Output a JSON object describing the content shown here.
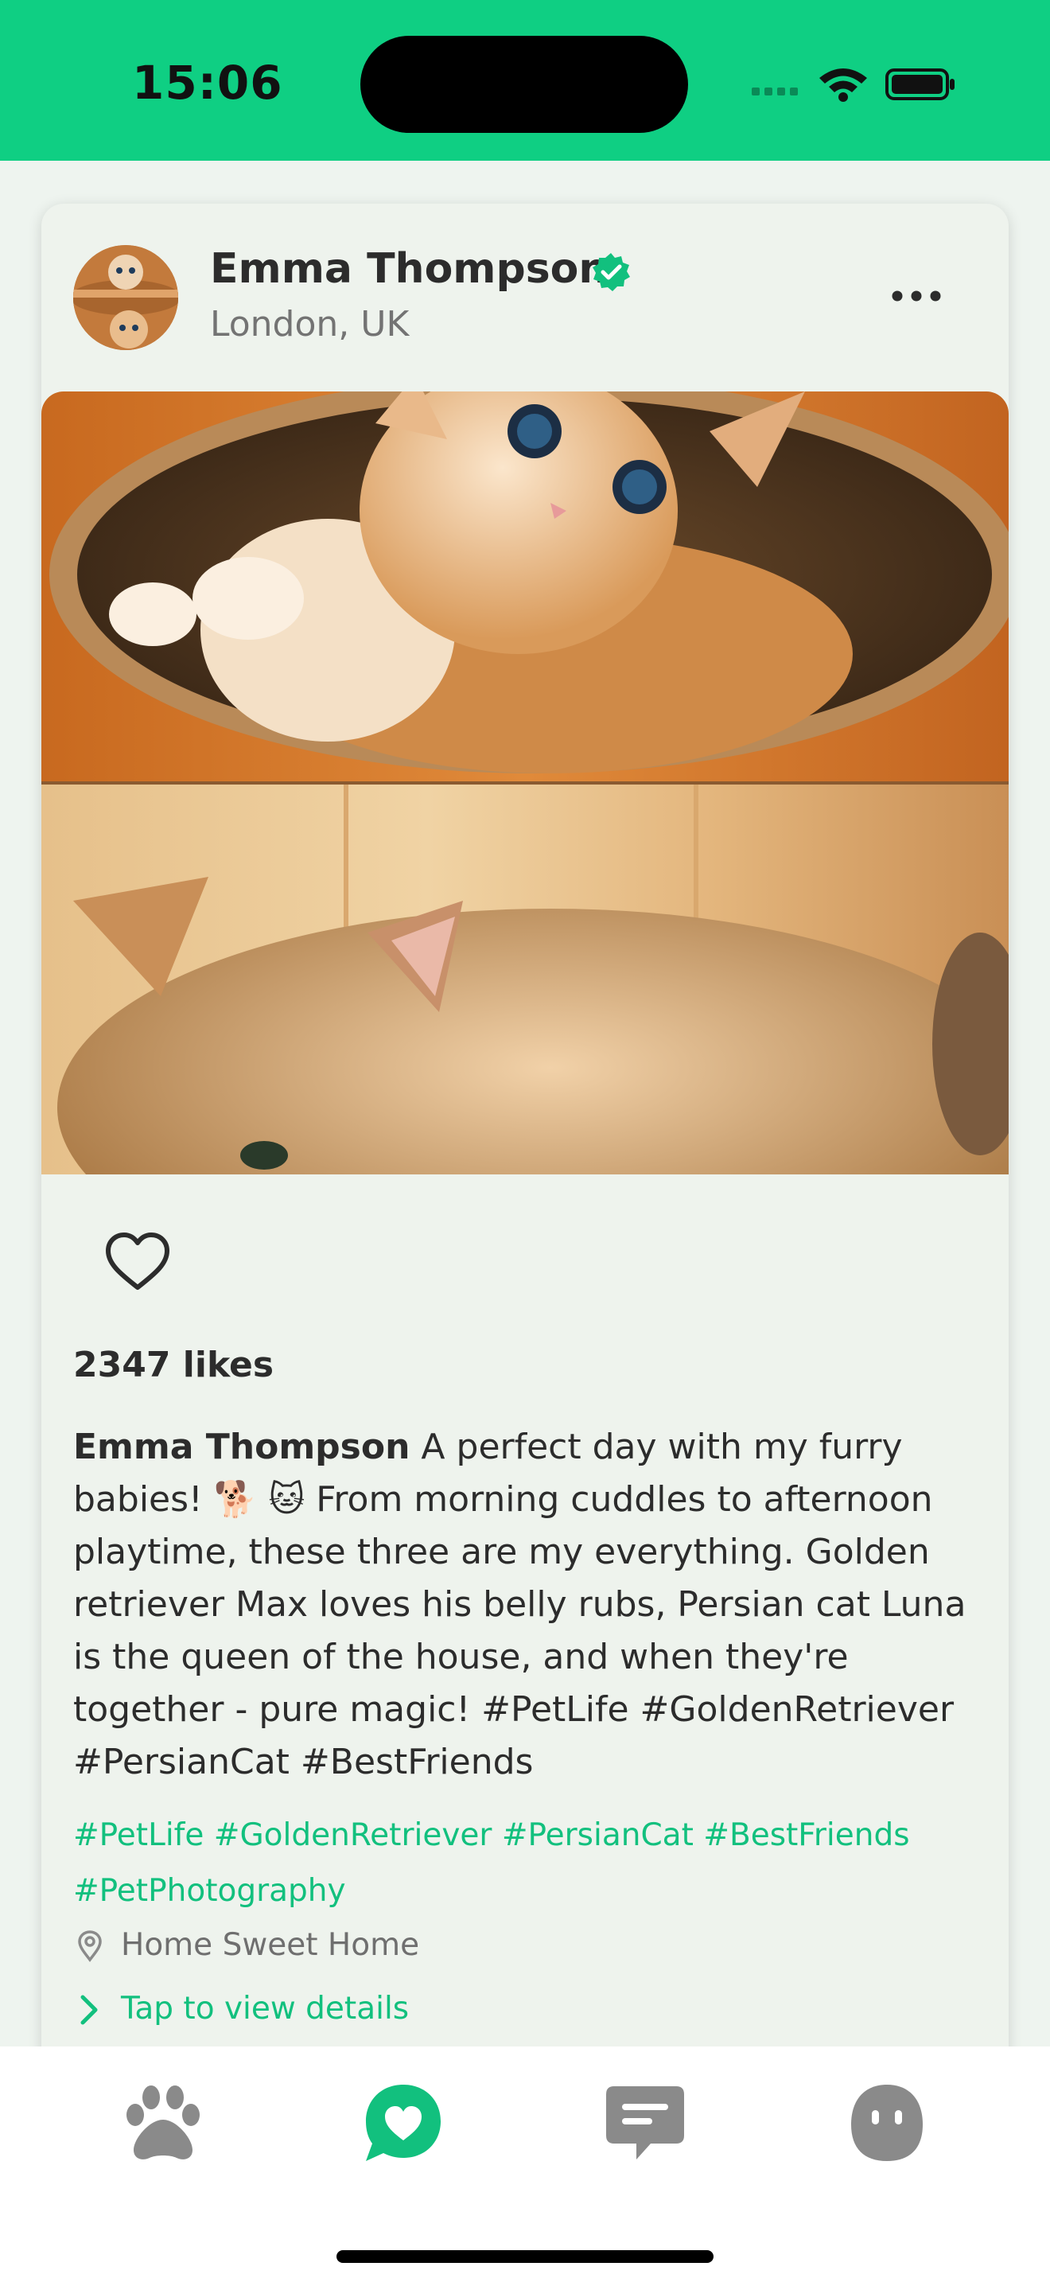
{
  "status_bar": {
    "time": "15:06",
    "background_color": "#0fcf83",
    "icons": [
      "cellular-signal-icon",
      "wifi-icon",
      "battery-icon"
    ]
  },
  "post": {
    "author": {
      "name": "Emma Thompson",
      "location": "London, UK",
      "verified": true,
      "verified_color": "#12c07e"
    },
    "more_icon": "more-horizontal-icon",
    "photo_description_icon": "pet-photo",
    "like_icon": "heart-outline-icon",
    "likes_text": "2347 likes",
    "caption": {
      "author": "Emma Thompson",
      "text": "A perfect day with my furry babies! 🐕 🐱  From morning cuddles to afternoon playtime, these three are my everything. Golden retriever Max loves his belly rubs, Persian cat Luna is the queen of the house, and when they're together - pure magic! #PetLife #GoldenRetriever #PersianCat #BestFriends"
    },
    "hashtags_line1": "#PetLife #GoldenRetriever #PersianCat #BestFriends",
    "hashtags_line2": "#PetPhotography",
    "place": "Home Sweet Home",
    "details_link": "Tap to view details",
    "accent_color": "#12c07e"
  },
  "tab_bar": {
    "tabs": [
      {
        "icon": "paw-icon",
        "active": false
      },
      {
        "icon": "heart-chat-icon",
        "active": true
      },
      {
        "icon": "message-icon",
        "active": false
      },
      {
        "icon": "profile-face-icon",
        "active": false
      }
    ],
    "active_color": "#12c07e",
    "inactive_color": "#8a8a8a"
  }
}
